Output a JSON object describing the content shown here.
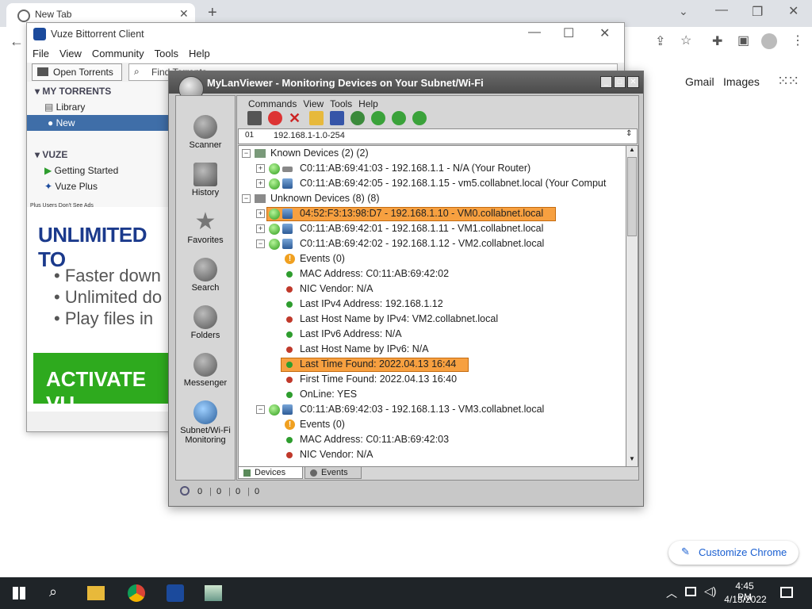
{
  "chrome": {
    "tab_title": "New Tab",
    "new_tab_symbol": "+",
    "links": [
      "Gmail",
      "Images"
    ],
    "customize_label": "Customize Chrome"
  },
  "vuze": {
    "title": "Vuze Bittorrent Client",
    "menu": [
      "File",
      "View",
      "Community",
      "Tools",
      "Help"
    ],
    "open_torrents": "Open Torrents",
    "search_placeholder": "Find Torrents",
    "sections": {
      "my_torrents": "MY TORRENTS",
      "library": "Library",
      "new": "New",
      "vuze": "VUZE",
      "getting_started": "Getting Started",
      "vuze_plus": "Vuze Plus"
    },
    "ad": {
      "small_note": "Plus Users Don't See Ads",
      "headline": "UNLIMITED TO",
      "bullets": [
        "Faster down",
        "Unlimited do",
        "Play files in"
      ],
      "cta": "ACTIVATE VU"
    }
  },
  "mlv": {
    "title": "MyLanViewer - Monitoring Devices on Your Subnet/Wi-Fi",
    "menu": [
      "Commands",
      "View",
      "Tools",
      "Help"
    ],
    "nav": [
      "Scanner",
      "History",
      "Favorites",
      "Search",
      "Folders",
      "Messenger",
      "Subnet/Wi-Fi Monitoring"
    ],
    "address_prefix": "01",
    "address": "192.168.1-1.0-254",
    "tree": [
      "Known Devices (2) (2)",
      "C0:11:AB:69:41:03 - 192.168.1.1 - N/A (Your Router)",
      "C0:11:AB:69:42:05 - 192.168.1.15 - vm5.collabnet.local (Your Comput",
      "Unknown Devices (8) (8)",
      "04:52:F3:13:98:D7 - 192.168.1.10 - VM0.collabnet.local",
      "C0:11:AB:69:42:01 - 192.168.1.11 - VM1.collabnet.local",
      "C0:11:AB:69:42:02 - 192.168.1.12 - VM2.collabnet.local",
      "Events (0)",
      "MAC Address: C0:11:AB:69:42:02",
      "NIC Vendor: N/A",
      "Last IPv4 Address: 192.168.1.12",
      "Last Host Name by IPv4: VM2.collabnet.local",
      "Last IPv6 Address: N/A",
      "Last Host Name by IPv6: N/A",
      "Last Time Found: 2022.04.13  16:44",
      "First Time Found: 2022.04.13  16:40",
      "OnLine: YES",
      "C0:11:AB:69:42:03 - 192.168.1.13 - VM3.collabnet.local",
      "Events (0)",
      "MAC Address: C0:11:AB:69:42:03",
      "NIC Vendor: N/A"
    ],
    "tabs": [
      "Devices",
      "Events"
    ],
    "status": [
      "0",
      "0",
      "0",
      "0"
    ]
  },
  "taskbar": {
    "time": "4:45 PM",
    "date": "4/13/2022"
  },
  "colors": {
    "highlight": "#f7a040",
    "green": "#2e9d2e",
    "red": "#c0392b"
  }
}
